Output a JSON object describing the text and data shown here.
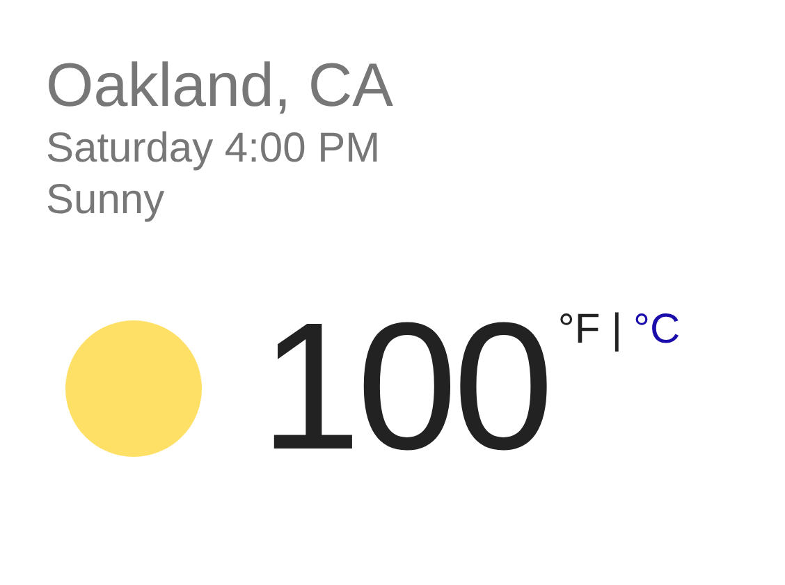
{
  "location": "Oakland, CA",
  "datetime": "Saturday 4:00 PM",
  "condition": "Sunny",
  "temperature": "100",
  "separator": "|",
  "units": [
    {
      "label": "°F",
      "selected": true
    },
    {
      "label": "°C",
      "selected": false
    }
  ]
}
